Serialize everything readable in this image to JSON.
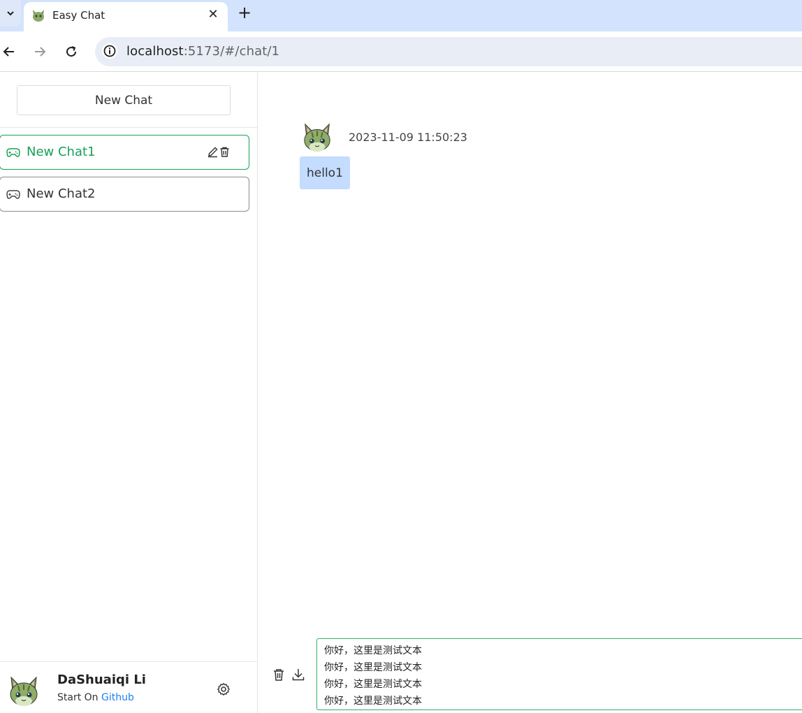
{
  "browser": {
    "tab_title": "Easy Chat",
    "url_host": "localhost",
    "url_path": ":5173/#/chat/1"
  },
  "sidebar": {
    "new_chat_label": "New Chat",
    "chats": [
      {
        "label": "New Chat1",
        "active": true
      },
      {
        "label": "New Chat2",
        "active": false
      }
    ],
    "user": {
      "name": "DaShuaiqi Li",
      "sub_prefix": "Start On ",
      "sub_link": "Github"
    }
  },
  "chat": {
    "messages": [
      {
        "time": "2023-11-09 11:50:23",
        "text": "hello1"
      }
    ],
    "input_value": "你好，这里是测试文本\n你好，这里是测试文本\n你好，这里是测试文本\n你好，这里是测试文本"
  },
  "colors": {
    "accent": "#18a058",
    "bubble": "#c3dcff",
    "link": "#2080f0",
    "chrome_tabbar": "#d3e3fd"
  }
}
